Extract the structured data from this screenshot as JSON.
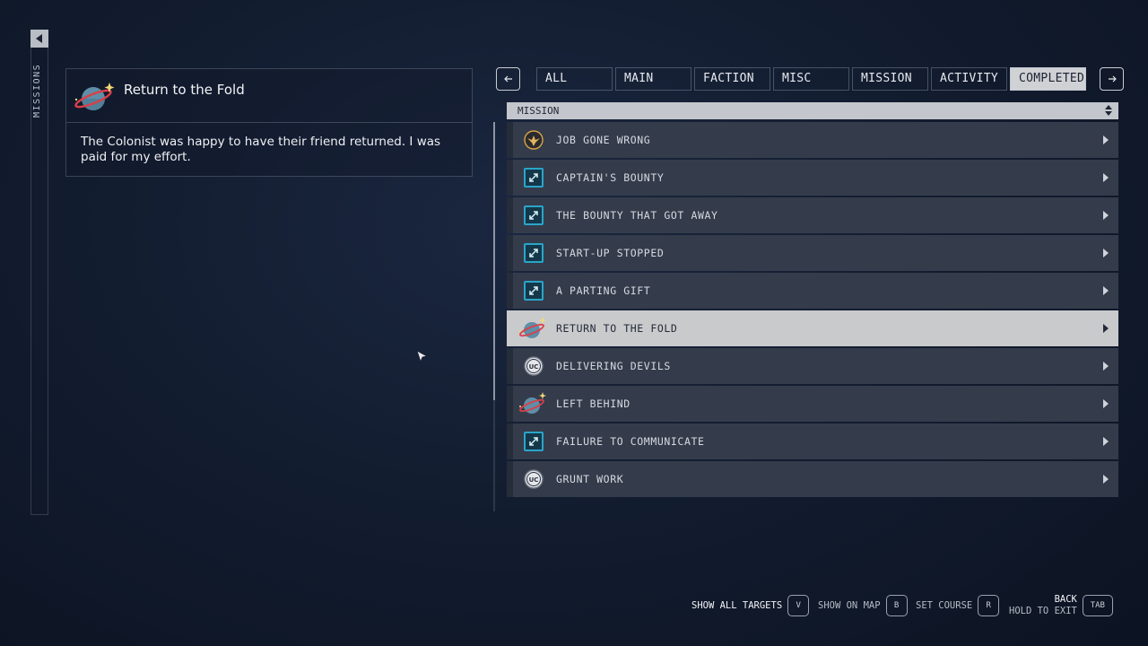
{
  "side_rail": {
    "label": "MISSIONS"
  },
  "detail": {
    "title": "Return to the Fold",
    "description": "The Colonist was happy to have their friend returned. I was paid for my effort.",
    "icon": "ringed-planet-icon"
  },
  "tabs": [
    {
      "label": "ALL",
      "active": false
    },
    {
      "label": "MAIN",
      "active": false
    },
    {
      "label": "FACTION",
      "active": false
    },
    {
      "label": "MISC",
      "active": false
    },
    {
      "label": "MISSION",
      "active": false
    },
    {
      "label": "ACTIVITY",
      "active": false
    },
    {
      "label": "COMPLETED",
      "active": true
    }
  ],
  "tab_nav": {
    "prev_icon": "arrow-left-icon",
    "next_icon": "arrow-right-icon"
  },
  "list": {
    "header": "MISSION",
    "rows": [
      {
        "label": "JOB GONE WRONG",
        "icon": "eagle-emblem-icon",
        "selected": false
      },
      {
        "label": "CAPTAIN'S BOUNTY",
        "icon": "bounty-board-icon",
        "selected": false
      },
      {
        "label": "THE BOUNTY THAT GOT AWAY",
        "icon": "bounty-board-icon",
        "selected": false
      },
      {
        "label": "START-UP STOPPED",
        "icon": "bounty-board-icon",
        "selected": false
      },
      {
        "label": "A PARTING GIFT",
        "icon": "bounty-board-icon",
        "selected": false
      },
      {
        "label": "RETURN TO THE FOLD",
        "icon": "ringed-planet-icon",
        "selected": true
      },
      {
        "label": "DELIVERING DEVILS",
        "icon": "uc-emblem-icon",
        "selected": false
      },
      {
        "label": "LEFT BEHIND",
        "icon": "ringed-planet-icon",
        "selected": false
      },
      {
        "label": "FAILURE TO COMMUNICATE",
        "icon": "bounty-board-icon",
        "selected": false
      },
      {
        "label": "GRUNT WORK",
        "icon": "uc-emblem-icon",
        "selected": false
      }
    ]
  },
  "footer": {
    "show_all_targets": {
      "label": "SHOW ALL TARGETS",
      "key": "V"
    },
    "show_on_map": {
      "label": "SHOW ON MAP",
      "key": "B"
    },
    "set_course": {
      "label": "SET COURSE",
      "key": "R"
    },
    "back": {
      "label": "BACK",
      "sublabel": "HOLD TO EXIT",
      "key": "TAB"
    }
  },
  "colors": {
    "accent_bounty": "#2aa5c9",
    "selected_row": "#c9cacc",
    "row_bg": "#343c4b",
    "planet_ring": "#d8404a"
  }
}
